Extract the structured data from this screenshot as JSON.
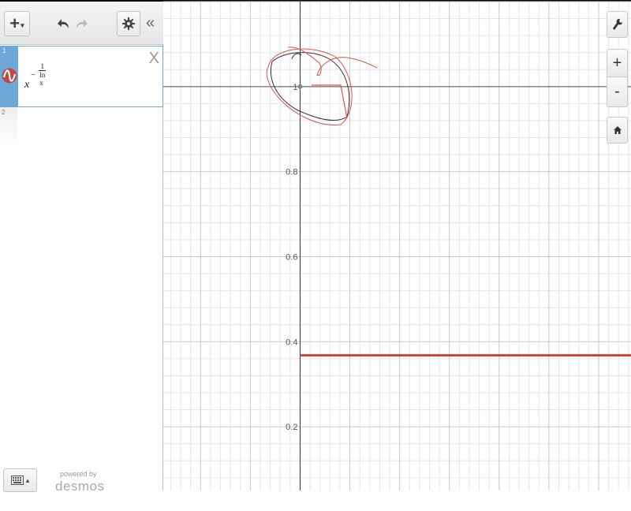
{
  "toolbar": {
    "add_label": "+",
    "add_caret": "▾",
    "collapse_label": "«"
  },
  "expressions": [
    {
      "index": "1",
      "base": "x",
      "exponent_sign": "−",
      "exponent_numerator": "1",
      "exponent_denominator": "ln x",
      "color": "#c74440",
      "delete_label": "X"
    },
    {
      "index": "2"
    }
  ],
  "keypad": {
    "caret": "▴"
  },
  "branding": {
    "powered_by": "powered by",
    "logo": "desmos"
  },
  "graph": {
    "y_ticks": [
      "1",
      "0.8",
      "0.6",
      "0.4",
      "0.2"
    ],
    "y_range": [
      0.05,
      1.2
    ],
    "x_range": [
      -0.55,
      1.33
    ],
    "curve_value": 0.3679,
    "curve_color": "#c74440",
    "grid_color_minor": "#e6e6e6",
    "grid_color_major": "#c8c8c8"
  },
  "controls": {
    "zoom_in": "+",
    "zoom_out": "-"
  }
}
